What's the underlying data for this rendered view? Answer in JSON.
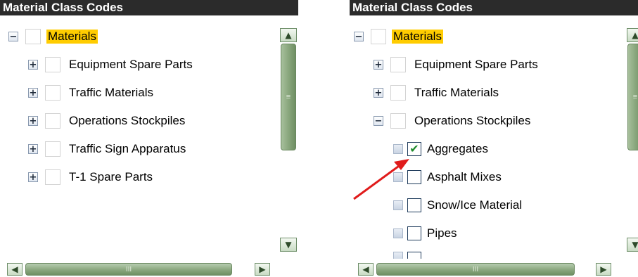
{
  "left_panel": {
    "title": "Material Class Codes",
    "root": {
      "expander": "−",
      "label": "Materials"
    },
    "children": [
      {
        "expander": "+",
        "label": "Equipment Spare Parts"
      },
      {
        "expander": "+",
        "label": "Traffic Materials"
      },
      {
        "expander": "+",
        "label": "Operations Stockpiles"
      },
      {
        "expander": "+",
        "label": "Traffic Sign Apparatus"
      },
      {
        "expander": "+",
        "label": "T-1 Spare Parts"
      }
    ],
    "vscroll": {
      "up": "▲",
      "down": "▼",
      "grip": "≡"
    },
    "hscroll": {
      "left": "◀",
      "right": "▶",
      "grip": "III"
    }
  },
  "right_panel": {
    "title": "Material Class Codes",
    "root": {
      "expander": "−",
      "label": "Materials"
    },
    "children": [
      {
        "expander": "+",
        "label": "Equipment Spare Parts"
      },
      {
        "expander": "+",
        "label": "Traffic Materials"
      },
      {
        "expander": "−",
        "label": "Operations Stockpiles"
      }
    ],
    "subitems": [
      {
        "label": "Aggregates",
        "checked": true,
        "tick": "✔"
      },
      {
        "label": "Asphalt Mixes",
        "checked": false
      },
      {
        "label": "Snow/Ice Material",
        "checked": false
      },
      {
        "label": "Pipes",
        "checked": false
      }
    ],
    "vscroll": {
      "up": "▲",
      "down": "▼",
      "grip": "≡"
    },
    "hscroll": {
      "left": "◀",
      "right": "▶",
      "grip": "III"
    }
  },
  "colors": {
    "title_bg": "#2b2b2b",
    "root_highlight": "#ffcc00",
    "arrow": "#e01b1b",
    "check": "#1f8a2c"
  }
}
